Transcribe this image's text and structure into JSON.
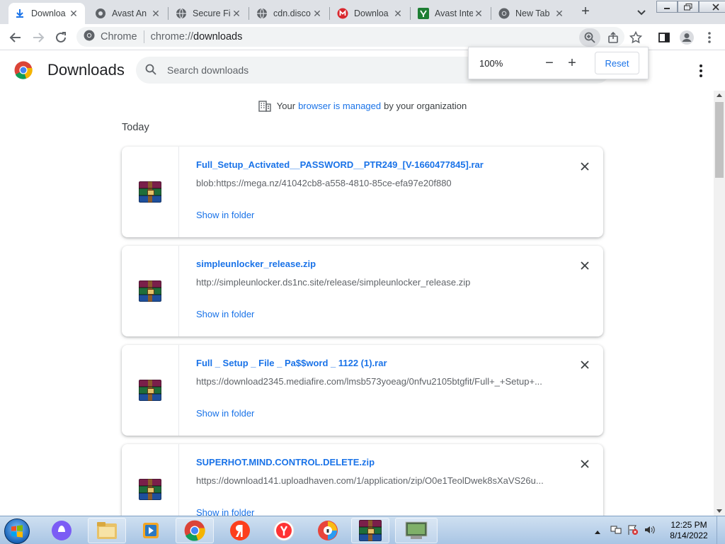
{
  "tabs": [
    {
      "title": "Downloa",
      "icon": "download-icon",
      "active": true
    },
    {
      "title": "Avast An",
      "icon": "avast-icon"
    },
    {
      "title": "Secure Fi",
      "icon": "globe-icon"
    },
    {
      "title": "cdn.disco",
      "icon": "globe-icon"
    },
    {
      "title": "Downloa",
      "icon": "mega-icon"
    },
    {
      "title": "Avast Inte",
      "icon": "avast-green-icon"
    },
    {
      "title": "New Tab",
      "icon": "chrome-icon"
    }
  ],
  "omnibox": {
    "scheme_label": "Chrome",
    "url_prefix": "chrome://",
    "url_path": "downloads"
  },
  "page": {
    "title": "Downloads",
    "search_placeholder": "Search downloads"
  },
  "zoom": {
    "level": "100%",
    "minus": "−",
    "plus": "+",
    "reset": "Reset"
  },
  "managed": {
    "prefix": "Your",
    "link": "browser is managed",
    "suffix": "by your organization"
  },
  "section_date": "Today",
  "downloads": [
    {
      "filename": "Full_Setup_Activated__PASSWORD__PTR249_[V-1660477845].rar",
      "url": "blob:https://mega.nz/41042cb8-a558-4810-85ce-efa97e20f880",
      "action": "Show in folder"
    },
    {
      "filename": "simpleunlocker_release.zip",
      "url": "http://simpleunlocker.ds1nc.site/release/simpleunlocker_release.zip",
      "action": "Show in folder"
    },
    {
      "filename": "Full _ Setup _ File _ Pa$$word _ 1122 (1).rar",
      "url": "https://download2345.mediafire.com/lmsb573yoeag/0nfvu2105btgfit/Full+_+Setup+...",
      "action": "Show in folder"
    },
    {
      "filename": "SUPERHOT.MIND.CONTROL.DELETE.zip",
      "url": "https://download141.uploadhaven.com/1/application/zip/O0e1TeolDwek8sXaVS26u...",
      "action": "Show in folder"
    }
  ],
  "clock": {
    "time": "12:25 PM",
    "date": "8/14/2022"
  },
  "colors": {
    "link": "#1a73e8",
    "tabstrip": "#dee1e6",
    "taskbar": "#a9c5e4"
  }
}
